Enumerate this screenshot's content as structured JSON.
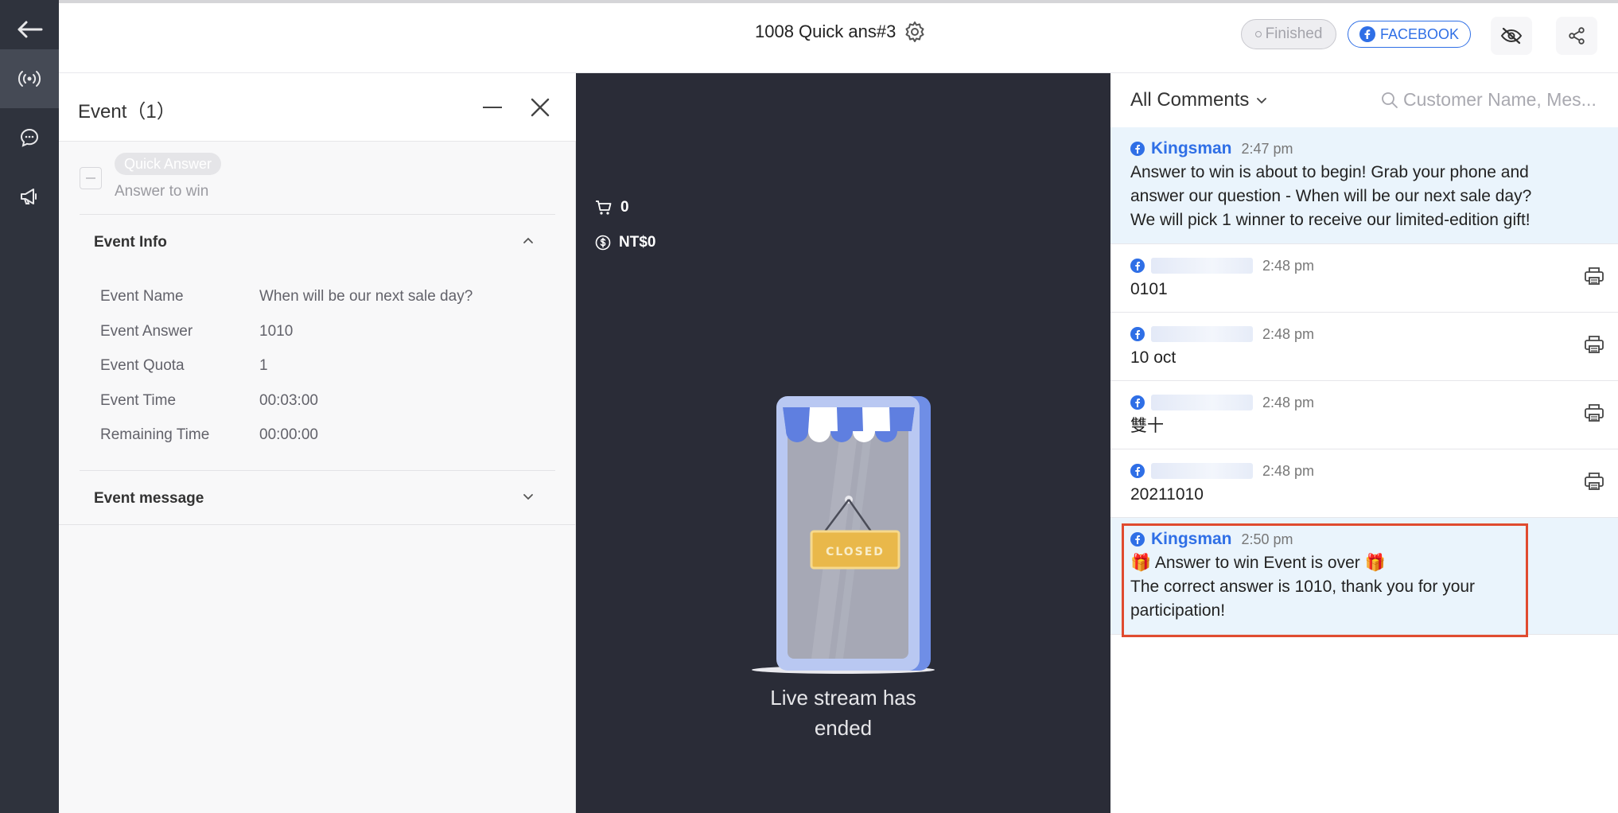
{
  "header": {
    "title": "1008 Quick ans#3",
    "status": "Finished",
    "platform": "FACEBOOK"
  },
  "event_panel": {
    "title": "Event（1）",
    "quick_answer_tag": "Quick Answer",
    "quick_answer_sub": "Answer to win",
    "info_section_title": "Event Info",
    "info_rows": [
      {
        "label": "Event Name",
        "value": "When will be our next sale day?"
      },
      {
        "label": "Event Answer",
        "value": "1010"
      },
      {
        "label": "Event Quota",
        "value": "1"
      },
      {
        "label": "Event Time",
        "value": "00:03:00"
      },
      {
        "label": "Remaining Time",
        "value": "00:00:00"
      }
    ],
    "message_section_title": "Event message"
  },
  "video": {
    "cart_count": "0",
    "revenue": "NT$0",
    "closed_sign": "CLOSED",
    "ended_line1": "Live stream has",
    "ended_line2": "ended"
  },
  "comments": {
    "filter_label": "All Comments",
    "search_placeholder": "Customer Name, Mes...",
    "items": [
      {
        "name": "Kingsman",
        "time": "2:47 pm",
        "lines": [
          "Answer to win is about to begin! Grab your phone and",
          "answer our question - When will be our next sale day?",
          "We will pick 1 winner to receive our limited-edition gift!"
        ]
      },
      {
        "name": "",
        "time": "2:48 pm",
        "lines": [
          "0101"
        ]
      },
      {
        "name": "",
        "time": "2:48 pm",
        "lines": [
          "10 oct"
        ]
      },
      {
        "name": "",
        "time": "2:48 pm",
        "lines": [
          "雙十"
        ]
      },
      {
        "name": "",
        "time": "2:48 pm",
        "lines": [
          "20211010"
        ]
      },
      {
        "name": "Kingsman",
        "time": "2:50 pm",
        "lines": [
          "🎁 Answer to win Event is over 🎁",
          "The correct answer is 1010, thank you for your",
          "participation!"
        ]
      }
    ]
  },
  "colors": {
    "nav_bg": "#2f333d",
    "video_bg": "#2a2c37",
    "accent": "#2f6fe6",
    "highlight_border": "#e04b2f"
  }
}
